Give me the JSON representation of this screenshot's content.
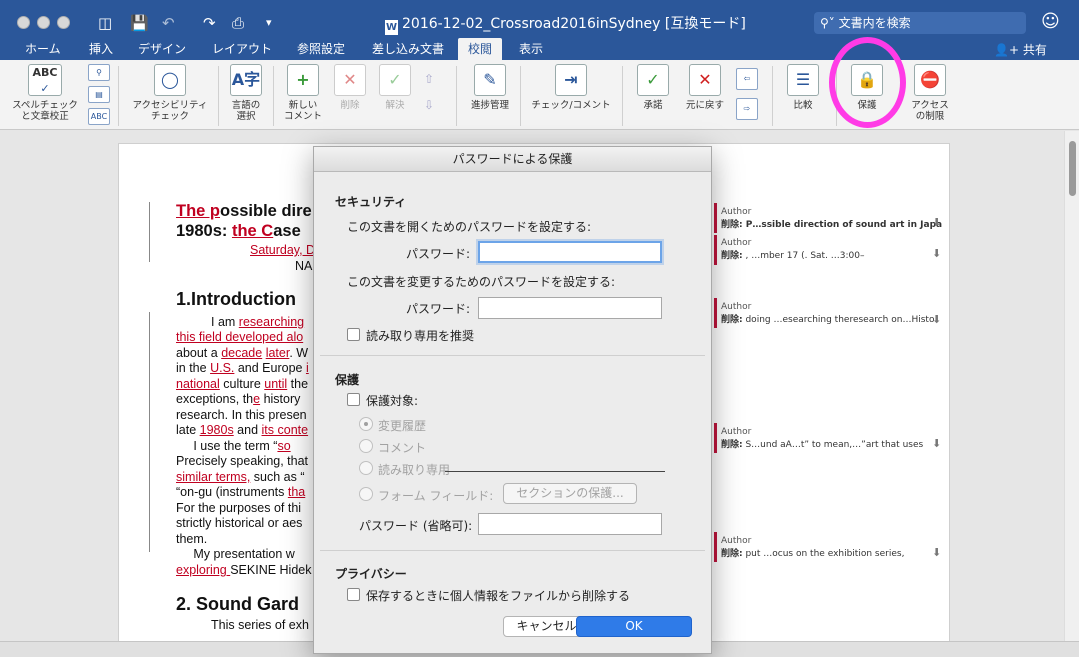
{
  "window": {
    "doc_title": "2016-12-02_Crossroad2016inSydney [互換モード]",
    "search_placeholder": "文書内を検索",
    "share_label": "共有"
  },
  "tabs": [
    "ホーム",
    "挿入",
    "デザイン",
    "レイアウト",
    "参照設定",
    "差し込み文書",
    "校閲",
    "表示"
  ],
  "active_tab": "校閲",
  "ribbon": {
    "spelling": "スペルチェック\nと文章校正",
    "accessibility": "アクセシビリティ\nチェック",
    "language": "言語の\n選択",
    "new_comment": "新しい\nコメント",
    "delete": "削除",
    "resolve": "解決",
    "track_changes": "進捗管理",
    "check_comment": "チェック/コメント",
    "accept": "承諾",
    "reject": "元に戻す",
    "compare": "比較",
    "protect": "保護",
    "restrict_access": "アクセス\nの制限"
  },
  "document": {
    "title_line1_rev": "The p",
    "title_line1_rest": "ossible dire",
    "title_line2_a": "1980s: ",
    "title_line2_rev": "the C",
    "title_line2_rest": "ase",
    "date_line": "Saturday, D",
    "name_line": "NA",
    "heading1": "1.Introduction",
    "heading2": "2. Sound Gard",
    "body": [
      {
        "a": "I am ",
        "r": "researching",
        "b": ""
      },
      {
        "a": "",
        "r": "this field developed alo",
        "b": ""
      },
      {
        "a": "about a ",
        "r": "decade",
        "b": " ",
        "r2": "later",
        "c": ". W"
      },
      {
        "a": "in the ",
        "r": "U.S.",
        "b": " and Europe ",
        "r2": "i",
        "c": ""
      },
      {
        "a": "",
        "r": "national",
        "b": " culture ",
        "r2": "until",
        "c": " the"
      },
      {
        "a": "exceptions, th",
        "r": "e",
        "b": " history "
      },
      {
        "a": "research. In this presen",
        "r": "",
        "b": ""
      },
      {
        "a": "late ",
        "r": "1980s",
        "b": " and ",
        "r2": "its conte",
        "c": ""
      },
      {
        "a": "     I use the term “",
        "r": "so",
        "b": ""
      },
      {
        "a": "Precisely speaking, that",
        "r": "",
        "b": ""
      },
      {
        "a": "",
        "r": "similar terms,",
        "b": " such as “",
        "r2": "",
        "c": ""
      },
      {
        "a": "“on-gu (instruments ",
        "r": "tha",
        "b": ""
      },
      {
        "a": "For the purposes of thi",
        "r": "",
        "b": ""
      },
      {
        "a": "strictly historical or aes",
        "r": "",
        "b": ""
      },
      {
        "a": "them.",
        "r": "",
        "b": ""
      },
      {
        "a": "     My presentation w",
        "r": "",
        "b": ""
      },
      {
        "a": "",
        "r": "exploring ",
        "b": "SEKINE Hidek"
      },
      {
        "a": "This series of exh",
        "r": "",
        "b": ""
      }
    ]
  },
  "comments": [
    {
      "author": "Author",
      "label": "削除:",
      "text": " P…ssible direction of sound art in Japa",
      "bold": true
    },
    {
      "author": "Author",
      "label": "削除:",
      "text": " , …mber 17 (. Sat. …3:00–",
      "bold": false
    },
    {
      "author": "Author",
      "label": "削除:",
      "text": " doing …esearching theresearch on…Histo",
      "bold": false
    },
    {
      "author": "Author",
      "label": "削除:",
      "text": " S…und aA…t” to mean,…”art that uses",
      "bold": false
    },
    {
      "author": "Author",
      "label": "削除:",
      "text": " put …ocus on the exhibition series,",
      "bold": false
    }
  ],
  "dialog": {
    "title": "パスワードによる保護",
    "security_heading": "セキュリティ",
    "open_pw_label": "この文書を開くためのパスワードを設定する:",
    "password_label": "パスワード:",
    "modify_pw_label": "この文書を変更するためのパスワードを設定する:",
    "readonly_label": "読み取り専用を推奨",
    "protection_heading": "保護",
    "protect_target_label": "保護対象:",
    "radio_track": "変更履歴",
    "radio_comment": "コメント",
    "radio_readonly": "読み取り専用",
    "radio_forms": "フォーム フィールド:",
    "section_protect_button": "セクションの保護...",
    "optional_pw_label": "パスワード (省略可):",
    "privacy_heading": "プライバシー",
    "privacy_label": "保存するときに個人情報をファイルから削除する",
    "cancel_button": "キャンセル",
    "ok_button": "OK"
  },
  "colors": {
    "brand": "#2b579a",
    "revision": "#c00020",
    "highlight_circle": "#ff3be6",
    "ok_button": "#2f7be8"
  }
}
